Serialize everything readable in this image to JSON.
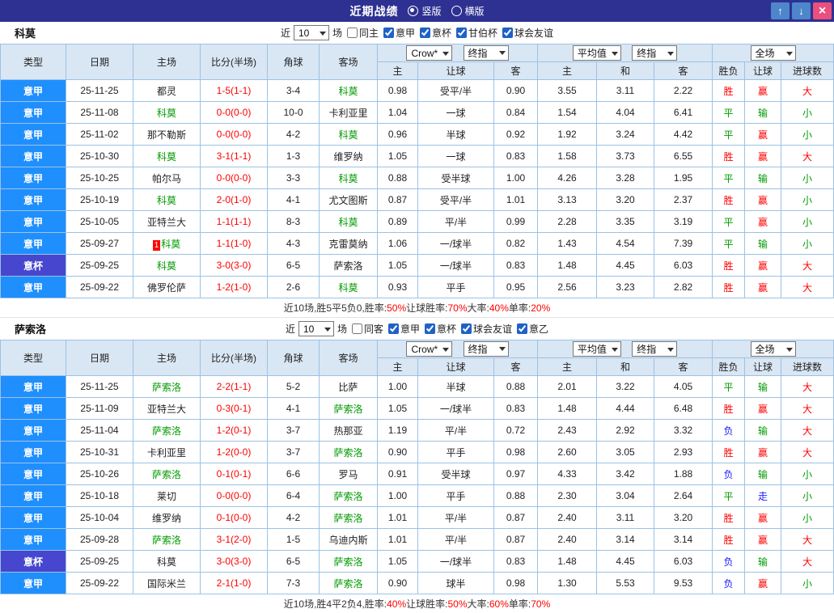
{
  "titlebar": {
    "title": "近期战绩",
    "layout_radios": [
      {
        "label": "竖版",
        "selected": true
      },
      {
        "label": "横版",
        "selected": false
      }
    ],
    "up_icon": "↑",
    "down_icon": "↓",
    "close_icon": "×",
    "colors": {
      "bar": "#2e3192",
      "button_blue": "#4d86ca",
      "button_close": "#ea4f7e"
    }
  },
  "table_head": {
    "type": "类型",
    "date": "日期",
    "home": "主场",
    "score": "比分(半场)",
    "corner": "角球",
    "away": "客场",
    "ah_selects": [
      "Crow*",
      "终指"
    ],
    "eu_selects": [
      "平均值",
      "终指"
    ],
    "ft_select": "全场",
    "sub_cols": [
      "主",
      "让球",
      "客",
      "主",
      "和",
      "客",
      "胜负",
      "让球",
      "进球数"
    ]
  },
  "colors": {
    "league_serie_a": "#1f8ffd",
    "league_coppa": "#4646cf",
    "win_red": "#fe0000",
    "draw_green": "#009a00",
    "lose_blue": "#1a1aff",
    "team_green": "#009a00"
  },
  "sections": [
    {
      "team": "科莫",
      "controls": {
        "recent_label": "近",
        "recent_value": "10",
        "matches_label": "场",
        "checkboxes": [
          {
            "label": "同主",
            "checked": false
          },
          {
            "label": "意甲",
            "checked": true
          },
          {
            "label": "意杯",
            "checked": true
          },
          {
            "label": "甘伯杯",
            "checked": true
          },
          {
            "label": "球会友谊",
            "checked": true
          }
        ]
      },
      "rows": [
        {
          "league": "意甲",
          "date": "25-11-25",
          "home": "都灵",
          "home_hl": false,
          "home_badge": "",
          "score": "1-5(1-1)",
          "corner": "3-4",
          "away": "科莫",
          "away_hl": true,
          "ah": [
            "0.98",
            "受平/半",
            "0.90"
          ],
          "eu": [
            "3.55",
            "3.11",
            "2.22"
          ],
          "res": [
            "胜",
            "赢",
            "大"
          ]
        },
        {
          "league": "意甲",
          "date": "25-11-08",
          "home": "科莫",
          "home_hl": true,
          "home_badge": "",
          "score": "0-0(0-0)",
          "corner": "10-0",
          "away": "卡利亚里",
          "away_hl": false,
          "ah": [
            "1.04",
            "一球",
            "0.84"
          ],
          "eu": [
            "1.54",
            "4.04",
            "6.41"
          ],
          "res": [
            "平",
            "输",
            "小"
          ]
        },
        {
          "league": "意甲",
          "date": "25-11-02",
          "home": "那不勒斯",
          "home_hl": false,
          "home_badge": "",
          "score": "0-0(0-0)",
          "corner": "4-2",
          "away": "科莫",
          "away_hl": true,
          "ah": [
            "0.96",
            "半球",
            "0.92"
          ],
          "eu": [
            "1.92",
            "3.24",
            "4.42"
          ],
          "res": [
            "平",
            "赢",
            "小"
          ]
        },
        {
          "league": "意甲",
          "date": "25-10-30",
          "home": "科莫",
          "home_hl": true,
          "home_badge": "",
          "score": "3-1(1-1)",
          "corner": "1-3",
          "away": "维罗纳",
          "away_hl": false,
          "ah": [
            "1.05",
            "一球",
            "0.83"
          ],
          "eu": [
            "1.58",
            "3.73",
            "6.55"
          ],
          "res": [
            "胜",
            "赢",
            "大"
          ]
        },
        {
          "league": "意甲",
          "date": "25-10-25",
          "home": "帕尔马",
          "home_hl": false,
          "home_badge": "",
          "score": "0-0(0-0)",
          "corner": "3-3",
          "away": "科莫",
          "away_hl": true,
          "ah": [
            "0.88",
            "受半球",
            "1.00"
          ],
          "eu": [
            "4.26",
            "3.28",
            "1.95"
          ],
          "res": [
            "平",
            "输",
            "小"
          ]
        },
        {
          "league": "意甲",
          "date": "25-10-19",
          "home": "科莫",
          "home_hl": true,
          "home_badge": "",
          "score": "2-0(1-0)",
          "corner": "4-1",
          "away": "尤文图斯",
          "away_hl": false,
          "ah": [
            "0.87",
            "受平/半",
            "1.01"
          ],
          "eu": [
            "3.13",
            "3.20",
            "2.37"
          ],
          "res": [
            "胜",
            "赢",
            "小"
          ]
        },
        {
          "league": "意甲",
          "date": "25-10-05",
          "home": "亚特兰大",
          "home_hl": false,
          "home_badge": "",
          "score": "1-1(1-1)",
          "corner": "8-3",
          "away": "科莫",
          "away_hl": true,
          "ah": [
            "0.89",
            "平/半",
            "0.99"
          ],
          "eu": [
            "2.28",
            "3.35",
            "3.19"
          ],
          "res": [
            "平",
            "赢",
            "小"
          ]
        },
        {
          "league": "意甲",
          "date": "25-09-27",
          "home": "科莫",
          "home_hl": true,
          "home_badge": "1",
          "score": "1-1(1-0)",
          "corner": "4-3",
          "away": "克雷莫纳",
          "away_hl": false,
          "ah": [
            "1.06",
            "一/球半",
            "0.82"
          ],
          "eu": [
            "1.43",
            "4.54",
            "7.39"
          ],
          "res": [
            "平",
            "输",
            "小"
          ]
        },
        {
          "league": "意杯",
          "date": "25-09-25",
          "home": "科莫",
          "home_hl": true,
          "home_badge": "",
          "score": "3-0(3-0)",
          "corner": "6-5",
          "away": "萨索洛",
          "away_hl": false,
          "ah": [
            "1.05",
            "一/球半",
            "0.83"
          ],
          "eu": [
            "1.48",
            "4.45",
            "6.03"
          ],
          "res": [
            "胜",
            "赢",
            "大"
          ]
        },
        {
          "league": "意甲",
          "date": "25-09-22",
          "home": "佛罗伦萨",
          "home_hl": false,
          "home_badge": "",
          "score": "1-2(1-0)",
          "corner": "2-6",
          "away": "科莫",
          "away_hl": true,
          "ah": [
            "0.93",
            "平手",
            "0.95"
          ],
          "eu": [
            "2.56",
            "3.23",
            "2.82"
          ],
          "res": [
            "胜",
            "赢",
            "大"
          ]
        }
      ],
      "summary": {
        "prefix": "近10场,胜5平5负0, ",
        "stats": [
          {
            "label": "胜率:",
            "value": "50%"
          },
          {
            "label": " 让球胜率:",
            "value": "70%"
          },
          {
            "label": " 大率:",
            "value": "40%"
          },
          {
            "label": " 单率:",
            "value": "20%"
          }
        ]
      }
    },
    {
      "team": "萨索洛",
      "controls": {
        "recent_label": "近",
        "recent_value": "10",
        "matches_label": "场",
        "checkboxes": [
          {
            "label": "同客",
            "checked": false
          },
          {
            "label": "意甲",
            "checked": true
          },
          {
            "label": "意杯",
            "checked": true
          },
          {
            "label": "球会友谊",
            "checked": true
          },
          {
            "label": "意乙",
            "checked": true
          }
        ]
      },
      "rows": [
        {
          "league": "意甲",
          "date": "25-11-25",
          "home": "萨索洛",
          "home_hl": true,
          "home_badge": "",
          "score": "2-2(1-1)",
          "corner": "5-2",
          "away": "比萨",
          "away_hl": false,
          "ah": [
            "1.00",
            "半球",
            "0.88"
          ],
          "eu": [
            "2.01",
            "3.22",
            "4.05"
          ],
          "res": [
            "平",
            "输",
            "大"
          ]
        },
        {
          "league": "意甲",
          "date": "25-11-09",
          "home": "亚特兰大",
          "home_hl": false,
          "home_badge": "",
          "score": "0-3(0-1)",
          "corner": "4-1",
          "away": "萨索洛",
          "away_hl": true,
          "ah": [
            "1.05",
            "一/球半",
            "0.83"
          ],
          "eu": [
            "1.48",
            "4.44",
            "6.48"
          ],
          "res": [
            "胜",
            "赢",
            "大"
          ]
        },
        {
          "league": "意甲",
          "date": "25-11-04",
          "home": "萨索洛",
          "home_hl": true,
          "home_badge": "",
          "score": "1-2(0-1)",
          "corner": "3-7",
          "away": "热那亚",
          "away_hl": false,
          "ah": [
            "1.19",
            "平/半",
            "0.72"
          ],
          "eu": [
            "2.43",
            "2.92",
            "3.32"
          ],
          "res": [
            "负",
            "输",
            "大"
          ]
        },
        {
          "league": "意甲",
          "date": "25-10-31",
          "home": "卡利亚里",
          "home_hl": false,
          "home_badge": "",
          "score": "1-2(0-0)",
          "corner": "3-7",
          "away": "萨索洛",
          "away_hl": true,
          "ah": [
            "0.90",
            "平手",
            "0.98"
          ],
          "eu": [
            "2.60",
            "3.05",
            "2.93"
          ],
          "res": [
            "胜",
            "赢",
            "大"
          ]
        },
        {
          "league": "意甲",
          "date": "25-10-26",
          "home": "萨索洛",
          "home_hl": true,
          "home_badge": "",
          "score": "0-1(0-1)",
          "corner": "6-6",
          "away": "罗马",
          "away_hl": false,
          "ah": [
            "0.91",
            "受半球",
            "0.97"
          ],
          "eu": [
            "4.33",
            "3.42",
            "1.88"
          ],
          "res": [
            "负",
            "输",
            "小"
          ]
        },
        {
          "league": "意甲",
          "date": "25-10-18",
          "home": "莱切",
          "home_hl": false,
          "home_badge": "",
          "score": "0-0(0-0)",
          "corner": "6-4",
          "away": "萨索洛",
          "away_hl": true,
          "ah": [
            "1.00",
            "平手",
            "0.88"
          ],
          "eu": [
            "2.30",
            "3.04",
            "2.64"
          ],
          "res": [
            "平",
            "走",
            "小"
          ]
        },
        {
          "league": "意甲",
          "date": "25-10-04",
          "home": "维罗纳",
          "home_hl": false,
          "home_badge": "",
          "score": "0-1(0-0)",
          "corner": "4-2",
          "away": "萨索洛",
          "away_hl": true,
          "ah": [
            "1.01",
            "平/半",
            "0.87"
          ],
          "eu": [
            "2.40",
            "3.11",
            "3.20"
          ],
          "res": [
            "胜",
            "赢",
            "小"
          ]
        },
        {
          "league": "意甲",
          "date": "25-09-28",
          "home": "萨索洛",
          "home_hl": true,
          "home_badge": "",
          "score": "3-1(2-0)",
          "corner": "1-5",
          "away": "乌迪内斯",
          "away_hl": false,
          "ah": [
            "1.01",
            "平/半",
            "0.87"
          ],
          "eu": [
            "2.40",
            "3.14",
            "3.14"
          ],
          "res": [
            "胜",
            "赢",
            "大"
          ]
        },
        {
          "league": "意杯",
          "date": "25-09-25",
          "home": "科莫",
          "home_hl": false,
          "home_badge": "",
          "score": "3-0(3-0)",
          "corner": "6-5",
          "away": "萨索洛",
          "away_hl": true,
          "ah": [
            "1.05",
            "一/球半",
            "0.83"
          ],
          "eu": [
            "1.48",
            "4.45",
            "6.03"
          ],
          "res": [
            "负",
            "输",
            "大"
          ]
        },
        {
          "league": "意甲",
          "date": "25-09-22",
          "home": "国际米兰",
          "home_hl": false,
          "home_badge": "",
          "score": "2-1(1-0)",
          "corner": "7-3",
          "away": "萨索洛",
          "away_hl": true,
          "ah": [
            "0.90",
            "球半",
            "0.98"
          ],
          "eu": [
            "1.30",
            "5.53",
            "9.53"
          ],
          "res": [
            "负",
            "赢",
            "小"
          ]
        }
      ],
      "summary": {
        "prefix": "近10场,胜4平2负4, ",
        "stats": [
          {
            "label": "胜率:",
            "value": "40%"
          },
          {
            "label": " 让球胜率:",
            "value": "50%"
          },
          {
            "label": " 大率:",
            "value": "60%"
          },
          {
            "label": " 单率:",
            "value": "70%"
          }
        ]
      }
    }
  ]
}
